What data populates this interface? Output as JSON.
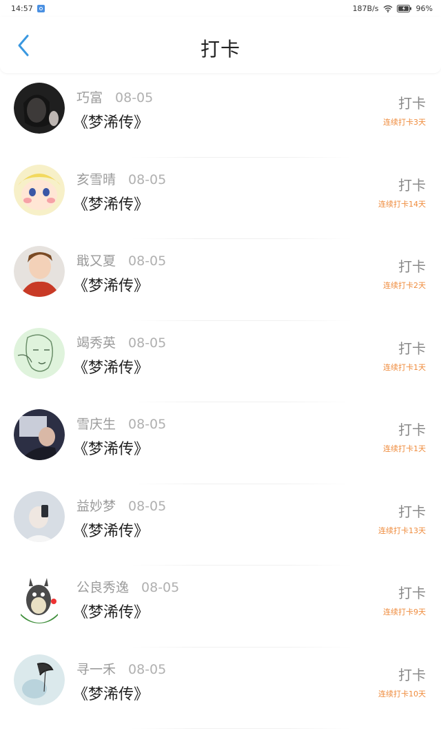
{
  "status_bar": {
    "time": "14:57",
    "net_speed": "187B/s",
    "battery": "96%"
  },
  "header": {
    "title": "打卡",
    "back_icon": "chevron-left-icon",
    "accent_color": "#3a98e0"
  },
  "items": [
    {
      "name": "巧富",
      "date": "08-05",
      "book": "《梦浠传》",
      "action": "打卡",
      "streak": "连续打卡3天",
      "avatar_color": "#2a2a2a"
    },
    {
      "name": "亥雪晴",
      "date": "08-05",
      "book": "《梦浠传》",
      "action": "打卡",
      "streak": "连续打卡14天",
      "avatar_color": "#f7e7a8"
    },
    {
      "name": "戢又夏",
      "date": "08-05",
      "book": "《梦浠传》",
      "action": "打卡",
      "streak": "连续打卡2天",
      "avatar_color": "#c3412a"
    },
    {
      "name": "竭秀英",
      "date": "08-05",
      "book": "《梦浠传》",
      "action": "打卡",
      "streak": "连续打卡1天",
      "avatar_color": "#d7f0d2"
    },
    {
      "name": "雪庆生",
      "date": "08-05",
      "book": "《梦浠传》",
      "action": "打卡",
      "streak": "连续打卡1天",
      "avatar_color": "#2f3346"
    },
    {
      "name": "益妙梦",
      "date": "08-05",
      "book": "《梦浠传》",
      "action": "打卡",
      "streak": "连续打卡13天",
      "avatar_color": "#cfd6de"
    },
    {
      "name": "公良秀逸",
      "date": "08-05",
      "book": "《梦浠传》",
      "action": "打卡",
      "streak": "连续打卡9天",
      "avatar_color": "#3f8a3a"
    },
    {
      "name": "寻一禾",
      "date": "08-05",
      "book": "《梦浠传》",
      "action": "打卡",
      "streak": "连续打卡10天",
      "avatar_color": "#cfe3e8"
    }
  ]
}
